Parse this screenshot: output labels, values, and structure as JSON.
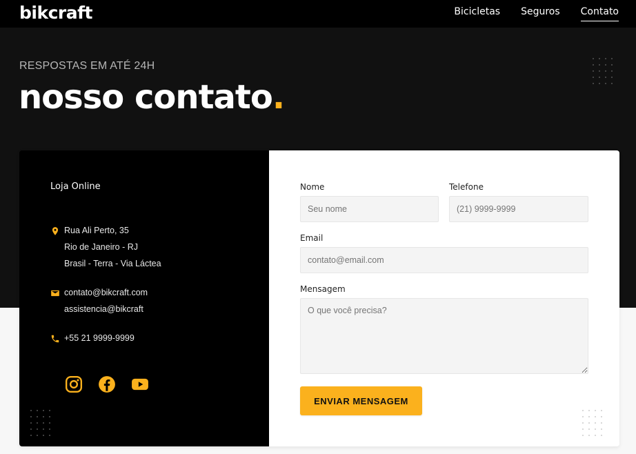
{
  "header": {
    "logo": "bikcraft",
    "nav": [
      {
        "label": "Bicicletas",
        "active": false
      },
      {
        "label": "Seguros",
        "active": false
      },
      {
        "label": "Contato",
        "active": true
      }
    ]
  },
  "hero": {
    "subtitle": "RESPOSTAS EM ATÉ 24H",
    "title": "nosso contato",
    "title_dot": "."
  },
  "contact_info": {
    "store_title": "Loja Online",
    "address": [
      "Rua Ali Perto, 35",
      "Rio de Janeiro - RJ",
      "Brasil - Terra - Via Láctea"
    ],
    "emails": [
      "contato@bikcraft.com",
      "assistencia@bikcraft"
    ],
    "phone": "+55 21 9999-9999",
    "icons": {
      "address": "location-pin-icon",
      "email": "envelope-icon",
      "phone": "phone-icon"
    },
    "social": [
      "instagram-icon",
      "facebook-icon",
      "youtube-icon"
    ]
  },
  "form": {
    "name": {
      "label": "Nome",
      "placeholder": "Seu nome"
    },
    "phone": {
      "label": "Telefone",
      "placeholder": "(21) 9999-9999"
    },
    "email": {
      "label": "Email",
      "placeholder": "contato@email.com"
    },
    "message": {
      "label": "Mensagem",
      "placeholder": "O que você precisa?"
    },
    "submit_label": "ENVIAR MENSAGEM"
  },
  "colors": {
    "accent": "#fbb11d",
    "header_bg": "#000000",
    "hero_bg": "#111111",
    "page_bg": "#f7f7f7"
  }
}
